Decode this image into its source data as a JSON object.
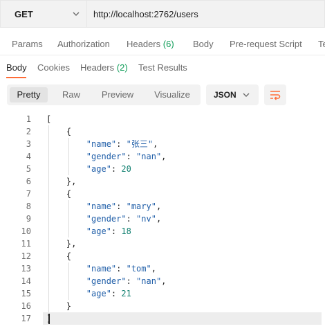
{
  "request": {
    "method": "GET",
    "url": "http://localhost:2762/users"
  },
  "request_tabs": [
    {
      "label": "Params",
      "count": ""
    },
    {
      "label": "Authorization",
      "count": ""
    },
    {
      "label": "Headers",
      "count": "(6)"
    },
    {
      "label": "Body",
      "count": ""
    },
    {
      "label": "Pre-request Script",
      "count": ""
    },
    {
      "label": "Te",
      "count": ""
    }
  ],
  "response_tabs": [
    {
      "label": "Body",
      "count": "",
      "active": true
    },
    {
      "label": "Cookies",
      "count": "",
      "active": false
    },
    {
      "label": "Headers",
      "count": "(2)",
      "active": false
    },
    {
      "label": "Test Results",
      "count": "",
      "active": false
    }
  ],
  "format_modes": [
    {
      "label": "Pretty",
      "active": true
    },
    {
      "label": "Raw",
      "active": false
    },
    {
      "label": "Preview",
      "active": false
    },
    {
      "label": "Visualize",
      "active": false
    }
  ],
  "language": "JSON",
  "icons": {
    "method_dropdown": "chevron-down-icon",
    "language_dropdown": "chevron-down-icon",
    "wrap": "wrap-lines-icon"
  },
  "colors": {
    "accent": "#ff6c37",
    "count_green": "#0f9d58",
    "json_key": "#1f5ea8",
    "json_number": "#0f7f6f"
  },
  "code_lines": [
    {
      "num": "1",
      "text": "["
    },
    {
      "num": "2",
      "text": "    {"
    },
    {
      "num": "3",
      "text": "        \"name\": \"张三\","
    },
    {
      "num": "4",
      "text": "        \"gender\": \"nan\","
    },
    {
      "num": "5",
      "text": "        \"age\": 20"
    },
    {
      "num": "6",
      "text": "    },"
    },
    {
      "num": "7",
      "text": "    {"
    },
    {
      "num": "8",
      "text": "        \"name\": \"mary\","
    },
    {
      "num": "9",
      "text": "        \"gender\": \"nv\","
    },
    {
      "num": "10",
      "text": "        \"age\": 18"
    },
    {
      "num": "11",
      "text": "    },"
    },
    {
      "num": "12",
      "text": "    {"
    },
    {
      "num": "13",
      "text": "        \"name\": \"tom\","
    },
    {
      "num": "14",
      "text": "        \"gender\": \"nan\","
    },
    {
      "num": "15",
      "text": "        \"age\": 21"
    },
    {
      "num": "16",
      "text": "    }"
    },
    {
      "num": "17",
      "text": "]"
    }
  ]
}
